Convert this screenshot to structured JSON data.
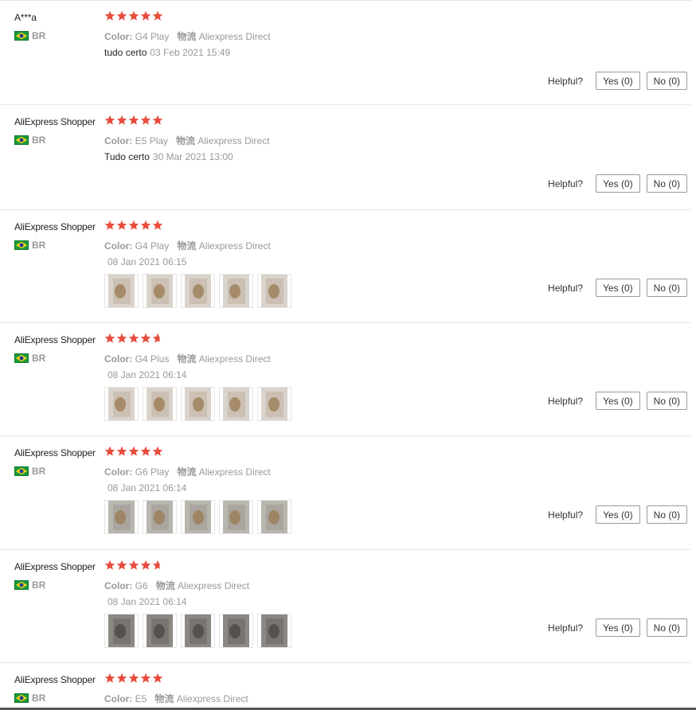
{
  "colors": {
    "star": "#e74c3c",
    "muted": "#999999",
    "border": "#e8e8e8"
  },
  "labels": {
    "color": "Color:",
    "logistics": "物流",
    "helpful": "Helpful?"
  },
  "reviews": [
    {
      "user": "A***a",
      "country": "BR",
      "rating": 5,
      "color": "G4 Play",
      "logistics": "Aliexpress Direct",
      "text": "tudo certo",
      "date": "03 Feb 2021 15:49",
      "photos": 0,
      "yes": "Yes (0)",
      "no": "No (0)"
    },
    {
      "user": "AliExpress Shopper",
      "country": "BR",
      "rating": 5,
      "color": "E5 Play",
      "logistics": "Aliexpress Direct",
      "text": "Tudo certo",
      "date": "30 Mar 2021 13:00",
      "photos": 0,
      "yes": "Yes (0)",
      "no": "No (0)"
    },
    {
      "user": "AliExpress Shopper",
      "country": "BR",
      "rating": 5,
      "color": "G4 Play",
      "logistics": "Aliexpress Direct",
      "text": "",
      "date": "08 Jan 2021 06:15",
      "photos": 5,
      "photo_tone": "light",
      "yes": "Yes (0)",
      "no": "No (0)"
    },
    {
      "user": "AliExpress Shopper",
      "country": "BR",
      "rating": 4.5,
      "color": "G4 Plus",
      "logistics": "Aliexpress Direct",
      "text": "",
      "date": "08 Jan 2021 06:14",
      "photos": 5,
      "photo_tone": "light",
      "yes": "Yes (0)",
      "no": "No (0)"
    },
    {
      "user": "AliExpress Shopper",
      "country": "BR",
      "rating": 5,
      "color": "G6 Play",
      "logistics": "Aliexpress Direct",
      "text": "",
      "date": "08 Jan 2021 06:14",
      "photos": 5,
      "photo_tone": "gray",
      "yes": "Yes (0)",
      "no": "No (0)"
    },
    {
      "user": "AliExpress Shopper",
      "country": "BR",
      "rating": 4.5,
      "color": "G6",
      "logistics": "Aliexpress Direct",
      "text": "",
      "date": "08 Jan 2021 06:14",
      "photos": 5,
      "photo_tone": "dark",
      "yes": "Yes (0)",
      "no": "No (0)"
    },
    {
      "user": "AliExpress Shopper",
      "country": "BR",
      "rating": 5,
      "color": "E5",
      "logistics": "Aliexpress Direct",
      "text": "",
      "date": "",
      "photos": 0,
      "yes": "",
      "no": ""
    }
  ]
}
